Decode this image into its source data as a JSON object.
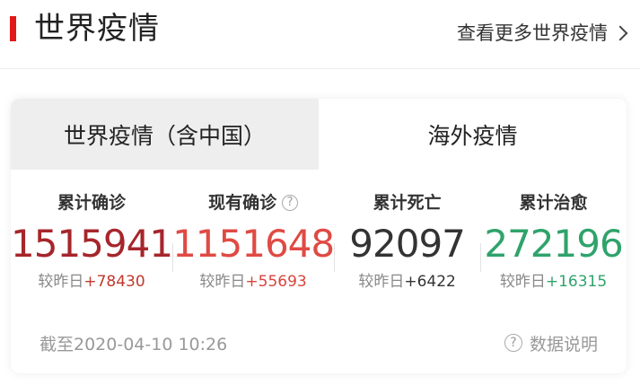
{
  "header": {
    "title": "世界疫情",
    "more_link": "查看更多世界疫情"
  },
  "tabs": [
    {
      "label": "世界疫情（含中国）",
      "active": false
    },
    {
      "label": "海外疫情",
      "active": true
    }
  ],
  "stats": [
    {
      "label": "累计确诊",
      "value": "1515941",
      "delta_prefix": "较昨日",
      "delta": "+78430",
      "color": "#a6262b",
      "delta_color": "#c0392b"
    },
    {
      "label": "现有确诊",
      "value": "1151648",
      "delta_prefix": "较昨日",
      "delta": "+55693",
      "color": "#e04a44",
      "delta_color": "#d9443d"
    },
    {
      "label": "累计死亡",
      "value": "92097",
      "delta_prefix": "较昨日",
      "delta": "+6422",
      "color": "#333333",
      "delta_color": "#333333"
    },
    {
      "label": "累计治愈",
      "value": "272196",
      "delta_prefix": "较昨日",
      "delta": "+16315",
      "color": "#2fa36b",
      "delta_color": "#2fa36b"
    }
  ],
  "help_icon_glyph": "?",
  "footer": {
    "timestamp": "截至2020-04-10 10:26",
    "explain": "数据说明"
  }
}
